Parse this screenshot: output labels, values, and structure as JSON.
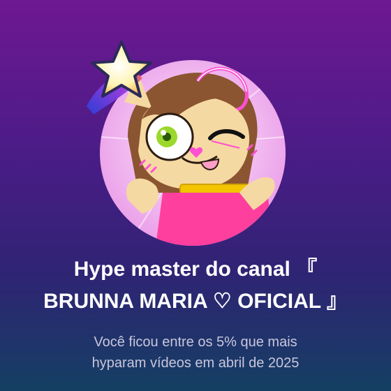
{
  "badge": {
    "icon": "hype-star-icon",
    "title_line1": "Hype master do canal 『",
    "title_line2": "BRUNNA MARIA ♡ OFICIAL 』",
    "subtitle_line1": "Você ficou entre os 5% que mais",
    "subtitle_line2": "hyparam vídeos em abril de 2025"
  },
  "avatar": {
    "icon": "channel-avatar"
  },
  "colors": {
    "background_top": "#6e1891",
    "background_bottom": "#143f63",
    "title": "#ffffff",
    "subtitle": "#c9c6dc",
    "avatar_bg": "#f6d4f4",
    "star": "#fff3b0"
  }
}
